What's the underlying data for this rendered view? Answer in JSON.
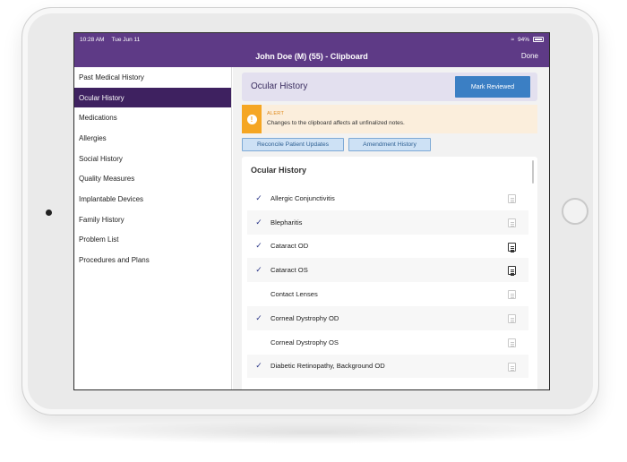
{
  "statusbar": {
    "time": "10:28 AM",
    "date": "Tue Jun 11",
    "battery": "94%"
  },
  "navbar": {
    "title": "John Doe (M) (55) - Clipboard",
    "done_label": "Done"
  },
  "sidebar": {
    "items": [
      {
        "label": "Past Medical History"
      },
      {
        "label": "Ocular History"
      },
      {
        "label": "Medications"
      },
      {
        "label": "Allergies"
      },
      {
        "label": "Social History"
      },
      {
        "label": "Quality Measures"
      },
      {
        "label": "Implantable Devices"
      },
      {
        "label": "Family History"
      },
      {
        "label": "Problem List"
      },
      {
        "label": "Procedures and Plans"
      }
    ]
  },
  "header": {
    "title": "Ocular History",
    "mark_reviewed_label": "Mark  Reviewed"
  },
  "alert": {
    "label": "ALERT",
    "message": "Changes to the clipboard affects all unfinalized notes."
  },
  "tabs": {
    "reconcile_label": "Reconcile Patient Updates",
    "amendment_label": "Amendment History"
  },
  "list": {
    "title": "Ocular History",
    "rows": [
      {
        "label": "Allergic Conjunctivitis",
        "checked": true,
        "note": "empty"
      },
      {
        "label": "Blepharitis",
        "checked": true,
        "note": "empty"
      },
      {
        "label": "Cataract OD",
        "checked": true,
        "note": "filled"
      },
      {
        "label": "Cataract OS",
        "checked": true,
        "note": "filled"
      },
      {
        "label": "Contact Lenses",
        "checked": false,
        "note": "empty"
      },
      {
        "label": "Corneal Dystrophy OD",
        "checked": true,
        "note": "empty"
      },
      {
        "label": "Corneal Dystrophy OS",
        "checked": false,
        "note": "empty"
      },
      {
        "label": "Diabetic Retinopathy, Background OD",
        "checked": true,
        "note": "empty"
      }
    ]
  },
  "colors": {
    "brand": "#5e3a86",
    "sidebar_active": "#3e2160",
    "button": "#3b7fc4",
    "alert": "#f5a623"
  }
}
